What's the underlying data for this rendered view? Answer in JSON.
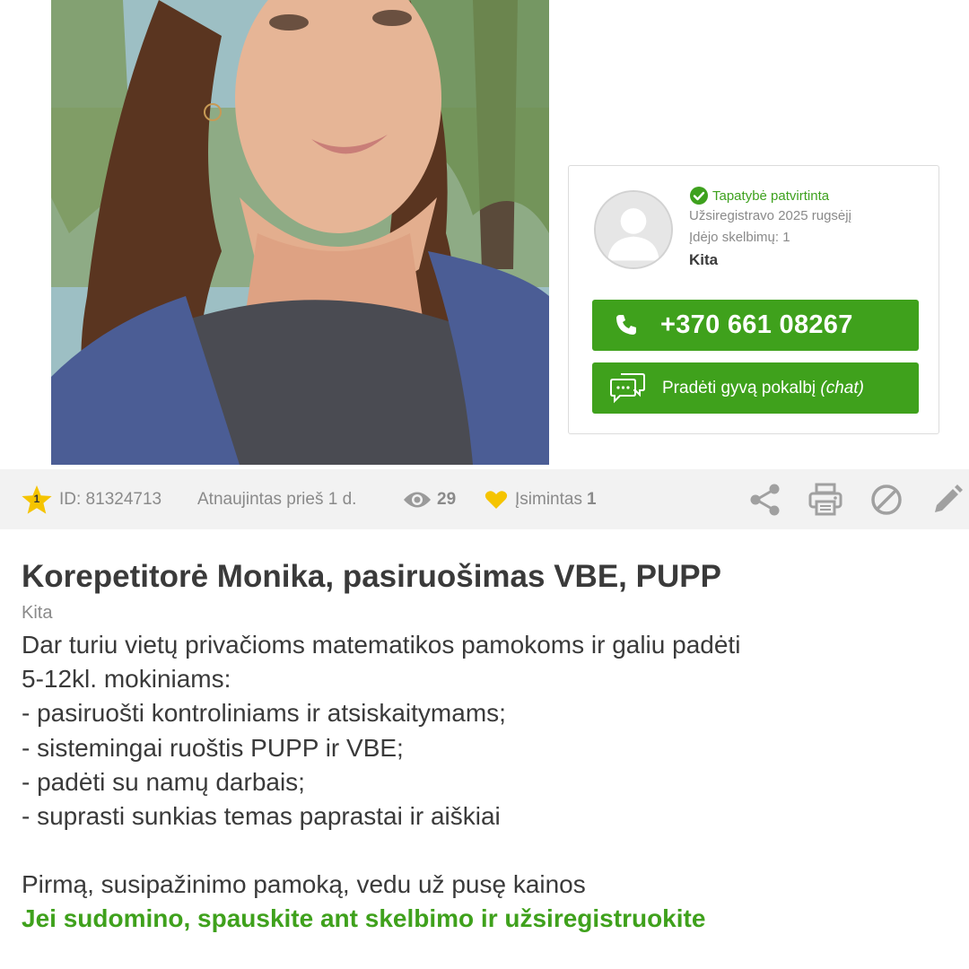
{
  "seller": {
    "verified_label": "Tapatybė patvirtinta",
    "registered": "Užsiregistravo 2025 rugsėjį",
    "ads_count": "Įdėjo skelbimų: 1",
    "category": "Kita"
  },
  "actions": {
    "phone": "+370 661 08267",
    "chat_label": "Pradėti gyvą pokalbį",
    "chat_suffix": "(chat)"
  },
  "stats": {
    "badge_number": "1",
    "id": "ID: 81324713",
    "updated": "Atnaujintas prieš 1 d.",
    "views": "29",
    "saved_label": "Įsimintas",
    "saved_count": "1"
  },
  "listing": {
    "title": "Korepetitorė Monika, pasiruošimas VBE, PUPP",
    "category": "Kita",
    "description_lines": [
      "Dar turiu vietų privačioms matematikos pamokoms ir galiu padėti",
      "5-12kl. mokiniams:",
      "- pasiruošti kontroliniams ir atsiskaitymams;",
      "- sistemingai ruoštis PUPP ir VBE;",
      "- padėti su namų darbais;",
      "- suprasti sunkias temas paprastai ir aiškiai"
    ],
    "offer": "Pirmą, susipažinimo pamoką, vedu už pusę kainos",
    "cta": "Jei sudomino, spauskite ant skelbimo ir užsiregistruokite"
  },
  "colors": {
    "accent_green": "#3fa11c",
    "muted_text": "#8a8a8a",
    "star_yellow": "#f5c400"
  }
}
